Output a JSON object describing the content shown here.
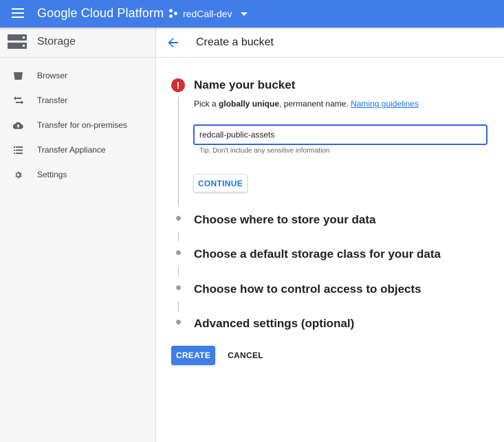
{
  "app": {
    "brand": "Google Cloud Platform",
    "project": "redCall-dev",
    "accent": "#3f7de8"
  },
  "sidebar": {
    "title": "Storage",
    "icon": "storage-icon",
    "items": [
      {
        "label": "Browser",
        "icon": "bucket-icon"
      },
      {
        "label": "Transfer",
        "icon": "transfer-arrows-icon"
      },
      {
        "label": "Transfer for on-premises",
        "icon": "cloud-upload-icon"
      },
      {
        "label": "Transfer Appliance",
        "icon": "appliance-list-icon"
      },
      {
        "label": "Settings",
        "icon": "gear-icon"
      }
    ]
  },
  "main": {
    "title": "Create a bucket",
    "steps": [
      {
        "title": "Name your bucket",
        "status": "error",
        "description_prefix": "Pick a ",
        "description_bold": "globally unique",
        "description_suffix": ", permanent name. ",
        "link": "Naming guidelines",
        "input_value": "redcall-public-assets",
        "tip": "Tip: Don't include any sensitive information",
        "continue_label": "CONTINUE"
      },
      {
        "title": "Choose where to store your data"
      },
      {
        "title": "Choose a default storage class for your data"
      },
      {
        "title": "Choose how to control access to objects"
      },
      {
        "title": "Advanced settings (optional)"
      }
    ],
    "create_label": "CREATE",
    "cancel_label": "CANCEL"
  },
  "colors": {
    "error": "#d32f2f",
    "link": "#1a73e8",
    "sidebar_bg": "#f6f6f6"
  }
}
